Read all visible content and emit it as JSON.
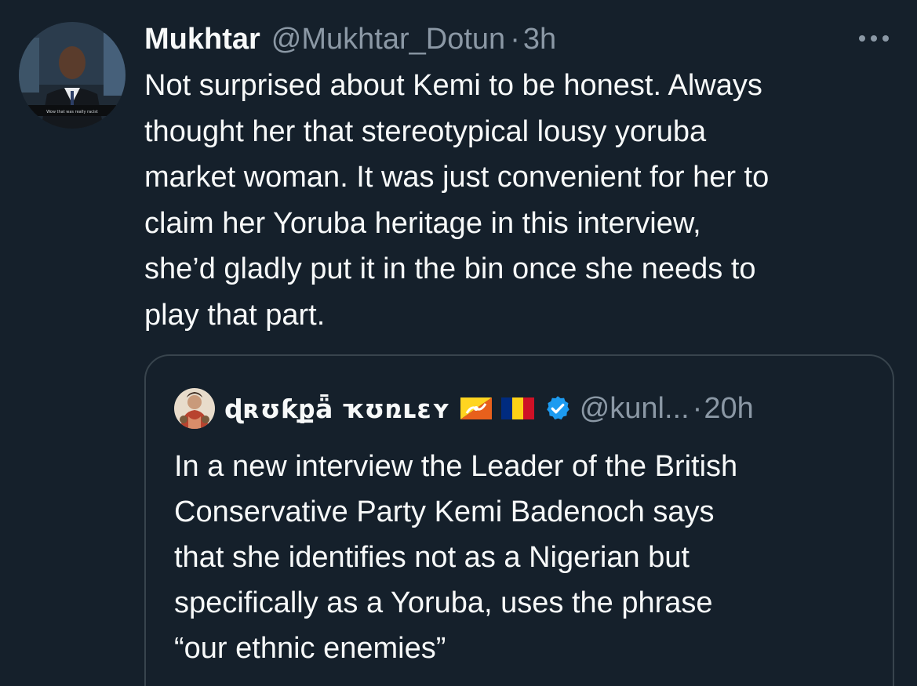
{
  "tweet": {
    "author_name": "Mukhtar",
    "author_handle": "@Mukhtar_Dotun",
    "separator": "·",
    "timestamp": "3h",
    "avatar_caption": "Wow that was really racist",
    "text": "Not surprised about Kemi to be honest. Always\nthought her that stereotypical lousy yoruba\nmarket woman. It was just convenient for her to\nclaim her Yoruba heritage in this interview,\nshe’d gladly put it in the bin once she needs to\nplay that part."
  },
  "quoted_tweet": {
    "author_name": "ɖʀʊƙքǟ ҡʊռʟɛʏ",
    "author_handle": "@kunl...",
    "separator": "·",
    "timestamp": "20h",
    "verified": true,
    "flags": [
      "bhutan-flag-icon",
      "romania-flag-icon"
    ],
    "text": "In a new interview the Leader of the British\nConservative Party Kemi Badenoch says\nthat she identifies not as a Nigerian but\nspecifically as a Yoruba, uses the phrase\n“our ethnic enemies”"
  },
  "colors": {
    "background": "#15202b",
    "primary_text": "#f7f9f9",
    "secondary_text": "#8b98a5",
    "border": "#38444d",
    "verified_blue": "#1d9bf0"
  }
}
